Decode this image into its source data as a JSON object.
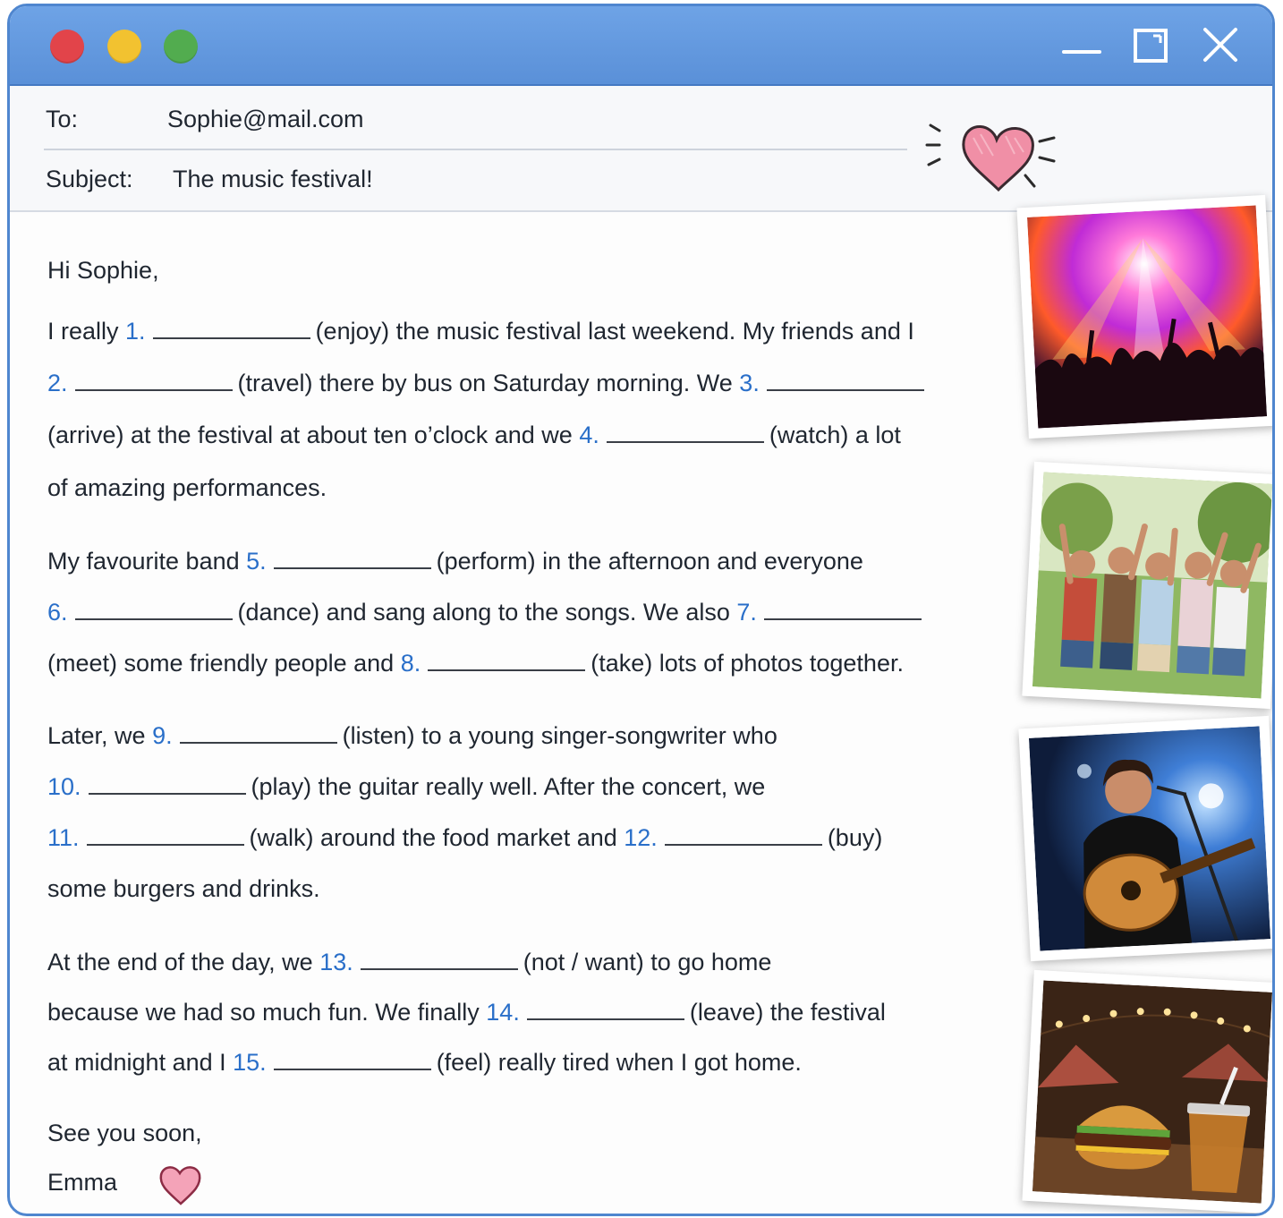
{
  "window": {
    "controls": [
      "minimize-icon",
      "maximize-icon",
      "close-icon"
    ],
    "traffic_lights": [
      "#e2444a",
      "#f2c230",
      "#52ac4f"
    ]
  },
  "header": {
    "to_label": "To:",
    "to_value": "Sophie@mail.com",
    "subject_label": "Subject:",
    "subject_value": "The music festival!"
  },
  "email": {
    "greeting": "Hi Sophie,",
    "paragraphs": [
      [
        [
          "I really ",
          "1.",
          "(enjoy) the music festival last weekend. My friends and I"
        ],
        [
          "",
          "2.",
          "(travel) there by bus on Saturday morning. We ",
          "3.",
          ""
        ],
        [
          "(arrive) at the festival at about ten o’clock and we ",
          "4.",
          "(watch) a lot"
        ],
        [
          "of amazing performances."
        ]
      ],
      [
        [
          "My favourite band ",
          "5.",
          "(perform) in the afternoon and everyone"
        ],
        [
          "",
          "6.",
          "(dance) and sang along to the songs. We also ",
          "7.",
          ""
        ],
        [
          "(meet) some friendly people and ",
          "8.",
          "(take) lots of photos together."
        ]
      ],
      [
        [
          "Later, we ",
          "9.",
          "(listen) to a young singer-songwriter who"
        ],
        [
          "",
          "10.",
          "(play) the guitar really well. After the concert, we"
        ],
        [
          "",
          "11.",
          "(walk) around the food market and ",
          "12.",
          "(buy)"
        ],
        [
          "some burgers and drinks."
        ]
      ],
      [
        [
          "At the end of the day, we ",
          "13.",
          "(not / want) to go home"
        ],
        [
          "because we had so much fun. We finally ",
          "14.",
          "(leave) the festival"
        ],
        [
          "at midnight and I ",
          "15.",
          "(feel) really tired when I got home."
        ]
      ]
    ],
    "closing": "See you soon,",
    "signature": "Emma"
  },
  "photos": [
    "concert-crowd-photo",
    "friends-group-photo",
    "guitarist-photo",
    "burger-drink-photo"
  ],
  "colors": {
    "accent": "#2a6fc9",
    "titlebar": "#5a90d8",
    "heart": "#f08fa6"
  }
}
